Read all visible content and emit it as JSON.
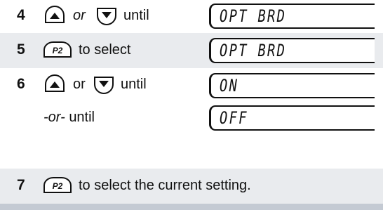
{
  "steps": [
    {
      "number": "4",
      "text_before": "",
      "or": "or",
      "text_after": "until",
      "display": "OPT BRD",
      "icons": [
        "up-arrow-key-icon",
        "down-arrow-key-icon"
      ]
    },
    {
      "number": "5",
      "key_label": "P2",
      "text": "to select",
      "display": "OPT BRD"
    },
    {
      "number": "6",
      "or": "or",
      "text_after": "until",
      "display": "ON",
      "icons": [
        "up-arrow-key-icon",
        "down-arrow-key-icon"
      ]
    },
    {
      "alt_prefix": "-or-",
      "alt_text": "until",
      "display": "OFF"
    },
    {
      "number": "7",
      "key_label": "P2",
      "text": "to select the current setting."
    }
  ],
  "colors": {
    "shade": "#e9ebee",
    "bar": "#c4cad3"
  }
}
